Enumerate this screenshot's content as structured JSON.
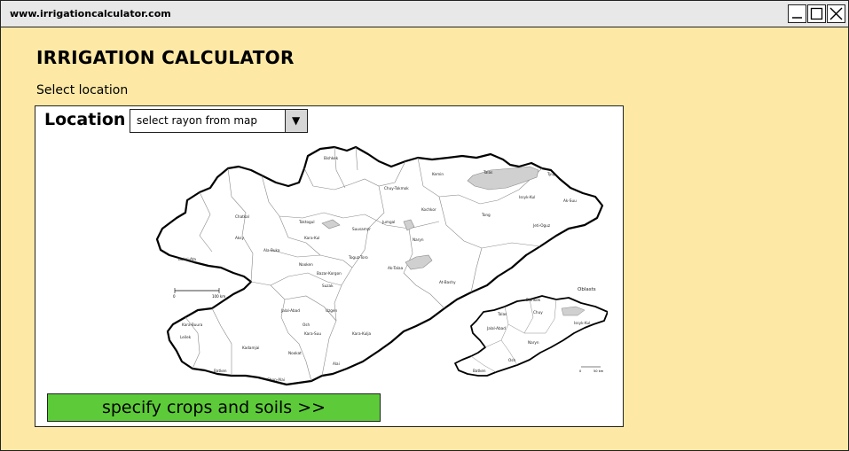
{
  "browser": {
    "url": "www.irrigationcalculator.com"
  },
  "app": {
    "title": "IRRIGATION CALCULATOR",
    "subtitle": "Select location"
  },
  "location": {
    "label": "Location",
    "select_value": "select rayon from map"
  },
  "map": {
    "scale_labels": [
      "0",
      "100 km"
    ],
    "scale_labels_inset": [
      "0",
      "50 km"
    ],
    "legend_label": "Oblasts",
    "region_labels": [
      "Talas",
      "Bishkek",
      "Chuy-Tokmok",
      "Kemin",
      "Tyup",
      "Ak-Suu",
      "Issyk-Kul",
      "Jeti-Oguz",
      "Tong",
      "Kochkor",
      "Jumgal",
      "Suusamyr",
      "Toktogul",
      "Kara-Kul",
      "Ala-Buka",
      "Chatkal",
      "Aksy",
      "Nooken",
      "Suzak",
      "Uzgen",
      "Jalal-Abad",
      "Osh",
      "Kara-Suu",
      "Kara-Kulja",
      "Alai",
      "Nookat",
      "Chon-Alai",
      "Kadamjai",
      "Batken",
      "Leilek",
      "At-Bashy",
      "Naryn",
      "Ak-Talaa",
      "Toguz-Toro",
      "Bazar-Korgon",
      "Kara-Buura",
      "Bakai-Ata"
    ],
    "inset_labels": [
      "Talas",
      "Chuy",
      "Issyk-Kul",
      "Jalal-Abad",
      "Naryn",
      "Osh",
      "Batken",
      "Bishkek"
    ]
  },
  "actions": {
    "next_label": "specify crops and soils >>"
  },
  "colors": {
    "page_bg": "#fde9a5",
    "titlebar_bg": "#e8e8e8",
    "button_green": "#5dcb39",
    "lake_gray": "#d0d0d0"
  }
}
